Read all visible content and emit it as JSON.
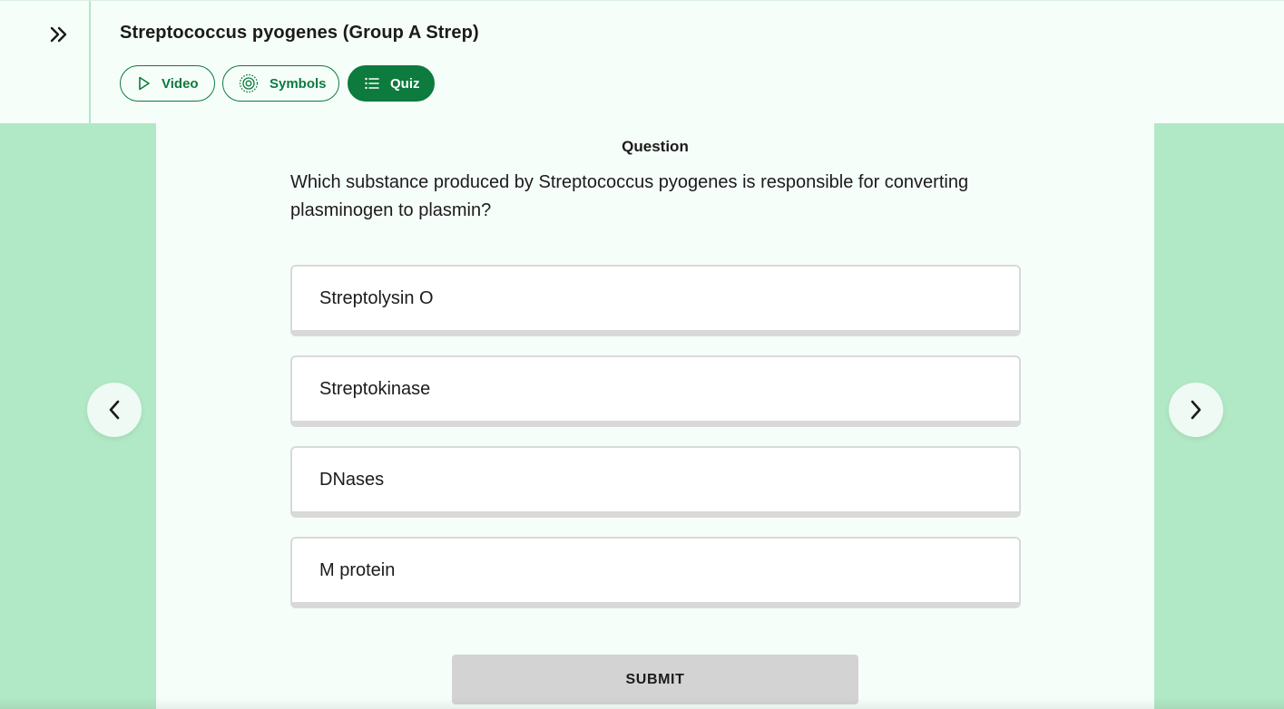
{
  "header": {
    "title": "Streptococcus pyogenes (Group A Strep)",
    "collapse_icon": "double-chevron-right-icon"
  },
  "tabs": [
    {
      "label": "Video",
      "icon": "play-icon",
      "active": false
    },
    {
      "label": "Symbols",
      "icon": "target-icon",
      "active": false
    },
    {
      "label": "Quiz",
      "icon": "list-icon",
      "active": true
    }
  ],
  "quiz": {
    "heading": "Question",
    "question": "Which substance produced by Streptococcus pyogenes is responsible for converting plasminogen to plasmin?",
    "options": [
      "Streptolysin O",
      "Streptokinase",
      "DNases",
      "M protein"
    ],
    "submit_label": "SUBMIT"
  },
  "navigation": {
    "prev_icon": "chevron-left-icon",
    "next_icon": "chevron-right-icon"
  },
  "colors": {
    "brand_green": "#0d7a3e",
    "background_green": "#b1e8c5",
    "panel": "#f6fefa",
    "submit_disabled": "#d3d3d3"
  }
}
